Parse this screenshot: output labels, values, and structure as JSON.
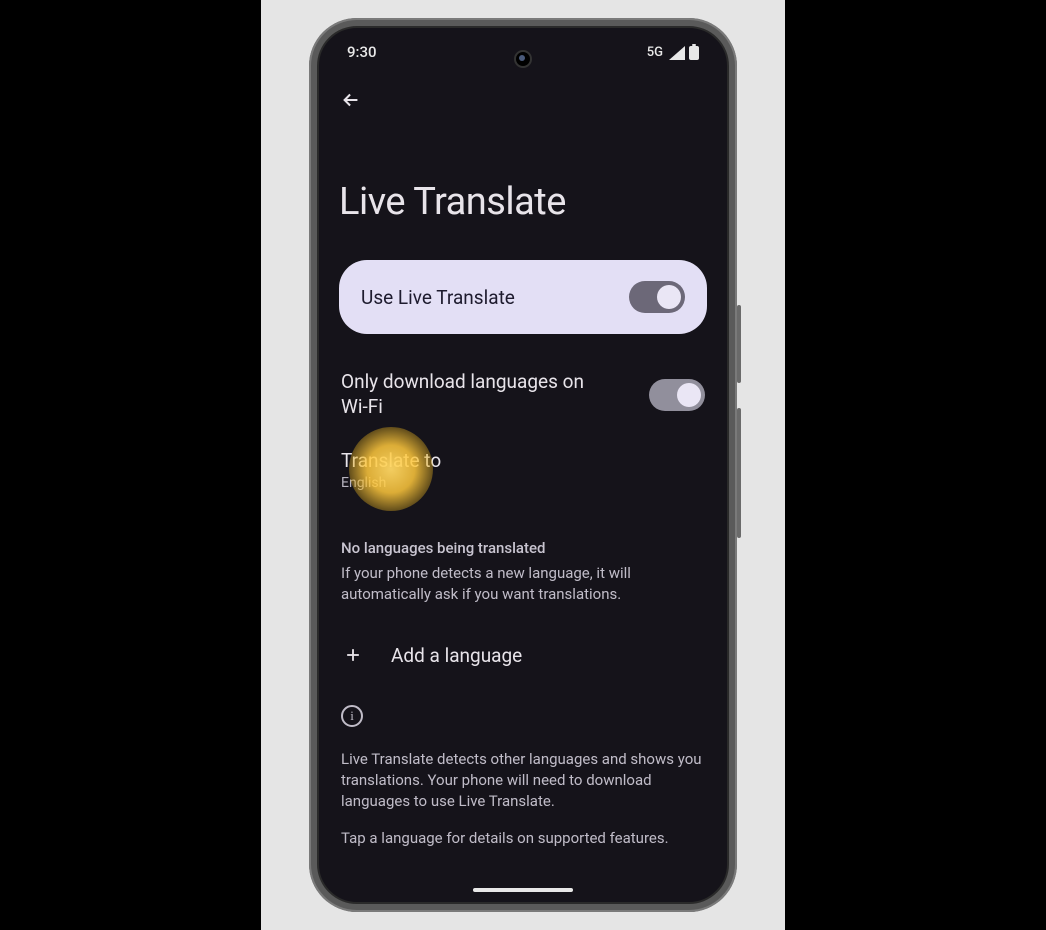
{
  "status": {
    "time": "9:30",
    "network": "5G"
  },
  "page": {
    "title": "Live Translate"
  },
  "mainToggle": {
    "label": "Use Live Translate",
    "on": true
  },
  "settings": {
    "wifiOnly": {
      "label": "Only download languages on Wi-Fi",
      "on": true
    },
    "translateTo": {
      "label": "Translate to",
      "value": "English"
    }
  },
  "languages": {
    "header": "No languages being translated",
    "desc": "If your phone detects a new language, it will automatically ask if you want translations.",
    "addLabel": "Add a language"
  },
  "info": {
    "p1": "Live Translate detects other languages and shows you translations. Your phone will need to download languages to use Live Translate.",
    "p2": "Tap a language for details on supported features."
  }
}
